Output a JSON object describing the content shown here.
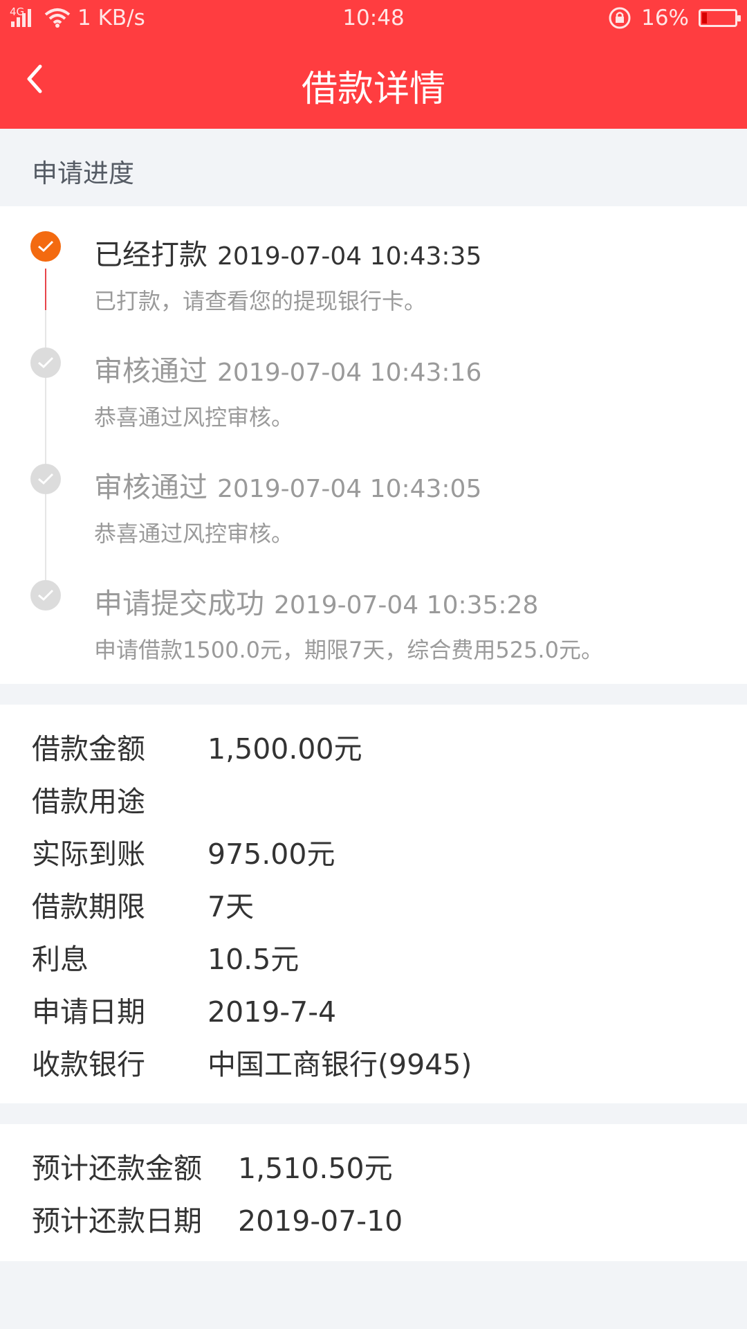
{
  "status_bar": {
    "network": "4G",
    "speed": "1 KB/s",
    "time": "10:48",
    "battery": "16%",
    "battery_level": 0.16
  },
  "nav": {
    "title": "借款详情"
  },
  "progress": {
    "title": "申请进度",
    "steps": [
      {
        "title": "已经打款",
        "time": "2019-07-04 10:43:35",
        "desc": "已打款，请查看您的提现银行卡。",
        "active": true
      },
      {
        "title": "审核通过",
        "time": "2019-07-04 10:43:16",
        "desc": "恭喜通过风控审核。",
        "active": false
      },
      {
        "title": "审核通过",
        "time": "2019-07-04 10:43:05",
        "desc": "恭喜通过风控审核。",
        "active": false
      },
      {
        "title": "申请提交成功",
        "time": "2019-07-04 10:35:28",
        "desc": "申请借款1500.0元，期限7天，综合费用525.0元。",
        "active": false
      }
    ]
  },
  "details": [
    {
      "label": "借款金额",
      "value": "1,500.00元"
    },
    {
      "label": "借款用途",
      "value": ""
    },
    {
      "label": "实际到账",
      "value": "975.00元"
    },
    {
      "label": "借款期限",
      "value": "7天"
    },
    {
      "label": "利息",
      "value": "10.5元"
    },
    {
      "label": "申请日期",
      "value": "2019-7-4"
    },
    {
      "label": "收款银行",
      "value": "中国工商银行(9945)"
    }
  ],
  "repayment": [
    {
      "label": "预计还款金额",
      "value": "1,510.50元"
    },
    {
      "label": "预计还款日期",
      "value": "2019-07-10"
    }
  ],
  "colors": {
    "header": "#ff3d40",
    "active_dot": "#f36a10",
    "inactive_dot": "#dcdcdc",
    "active_line": "#e8434a",
    "background": "#f2f4f7"
  }
}
